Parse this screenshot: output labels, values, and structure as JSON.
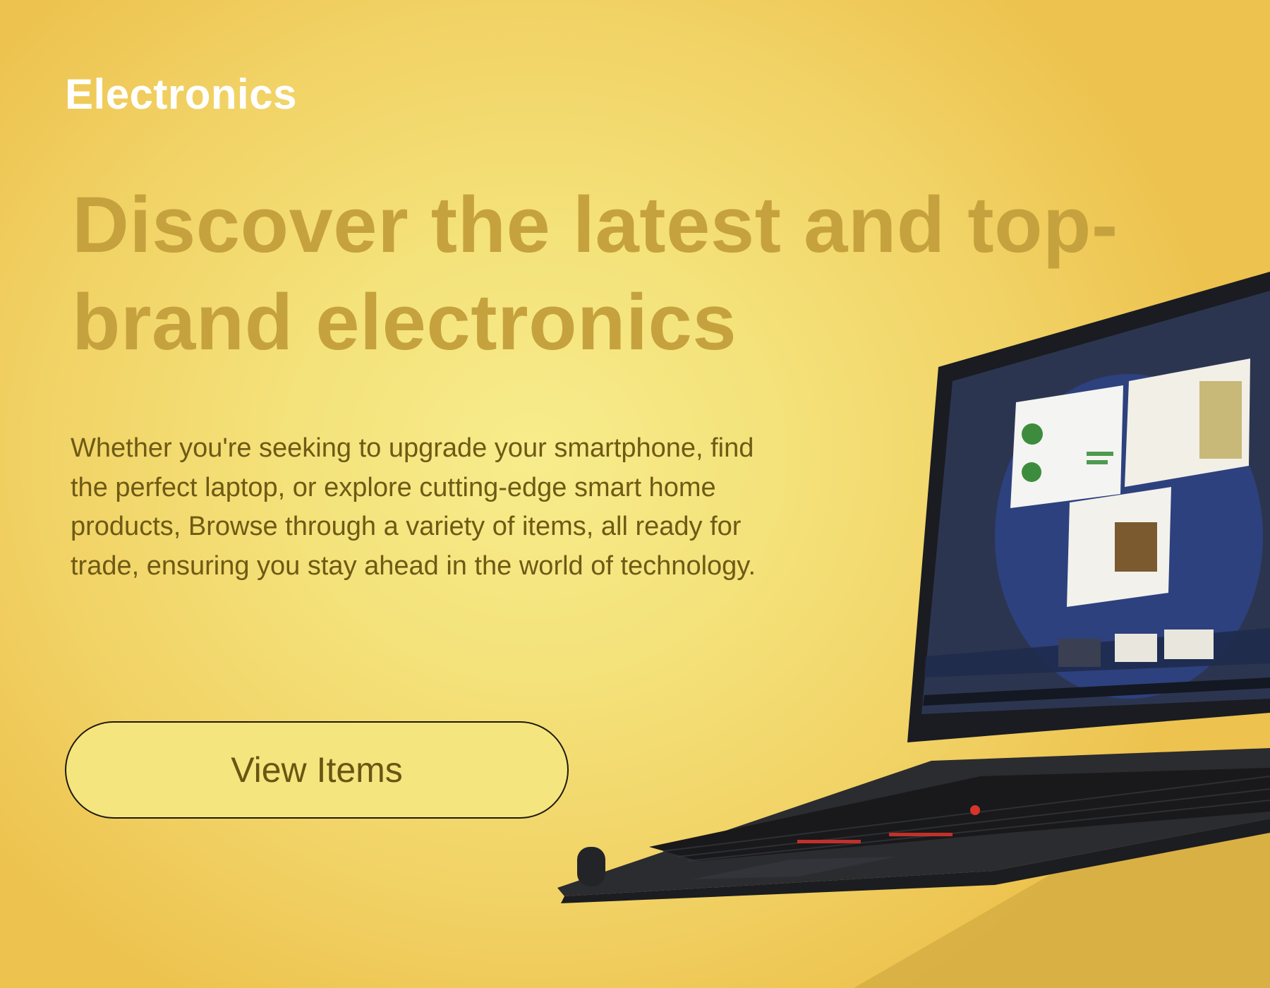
{
  "banner": {
    "category": "Electronics",
    "headline": "Discover the latest and top-brand electronics",
    "description": "Whether you're seeking to upgrade your smartphone, find the perfect laptop, or explore cutting-edge smart home products, Browse through a variety of items, all ready for trade, ensuring you stay ahead in the world of technology.",
    "cta_label": "View Items"
  },
  "colors": {
    "background": "#f4e27a",
    "headline": "#c6a23e",
    "body_text": "#6e5a14",
    "button_fill": "#f5e57f"
  },
  "images": {
    "product": "laptop-tablet-with-detachable-keyboard"
  }
}
